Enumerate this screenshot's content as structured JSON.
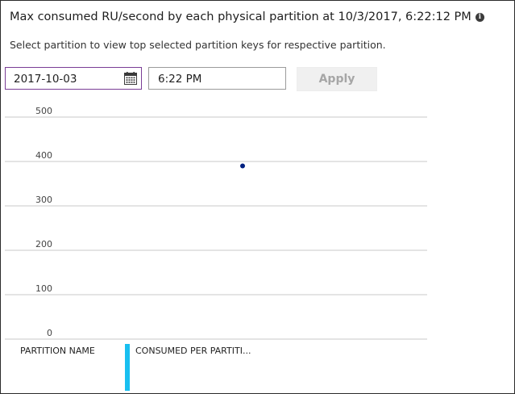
{
  "header": {
    "title": "Max consumed RU/second by each physical partition at 10/3/2017, 6:22:12 PM",
    "info_icon": "info-icon",
    "subtitle": "Select partition to view top selected partition keys for respective partition."
  },
  "filters": {
    "date_value": "2017-10-03",
    "calendar_icon": "calendar-icon",
    "time_value": "6:22 PM",
    "apply_label": "Apply"
  },
  "chart_data": {
    "type": "scatter",
    "title": "",
    "xlabel": "",
    "ylabel": "",
    "ylim": [
      0,
      500
    ],
    "yticks": [
      "500",
      "400",
      "300",
      "200",
      "100",
      "0"
    ],
    "grid": true,
    "series": [
      {
        "color": "#002080",
        "points": [
          {
            "x": 1,
            "y": 390
          }
        ]
      }
    ]
  },
  "legend": {
    "col1": "PARTITION NAME",
    "col2": "CONSUMED PER PARTITI...",
    "series_color": "#18bff0"
  },
  "colors": {
    "focus_border": "#7a3d96",
    "point": "#002080",
    "legend_bar": "#18bff0"
  }
}
